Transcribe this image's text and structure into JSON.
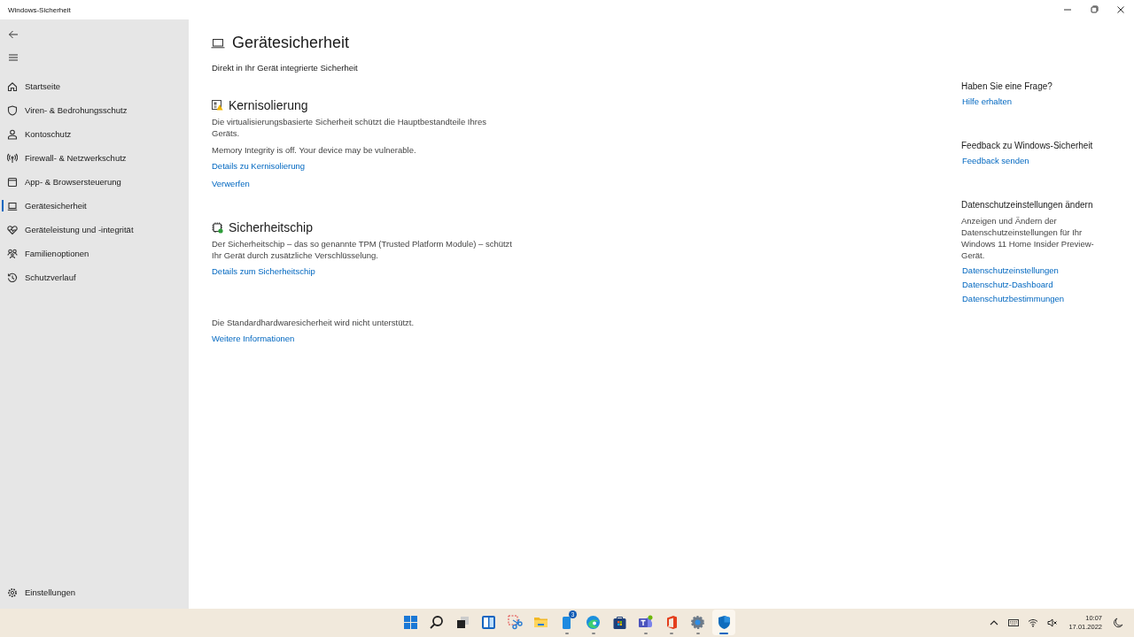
{
  "window": {
    "title": "Windows-Sicherheit"
  },
  "sidebar": {
    "items": [
      {
        "label": "Startseite",
        "selected": false
      },
      {
        "label": "Viren- & Bedrohungsschutz",
        "selected": false
      },
      {
        "label": "Kontoschutz",
        "selected": false
      },
      {
        "label": "Firewall- & Netzwerkschutz",
        "selected": false
      },
      {
        "label": "App- & Browsersteuerung",
        "selected": false
      },
      {
        "label": "Gerätesicherheit",
        "selected": true
      },
      {
        "label": "Geräteleistung und -integrität",
        "selected": false
      },
      {
        "label": "Familienoptionen",
        "selected": false
      },
      {
        "label": "Schutzverlauf",
        "selected": false
      }
    ],
    "footer": {
      "label": "Einstellungen"
    }
  },
  "page": {
    "title": "Gerätesicherheit",
    "subtitle": "Direkt in Ihr Gerät integrierte Sicherheit",
    "sections": [
      {
        "title": "Kernisolierung",
        "texts": [
          "Die virtualisierungsbasierte Sicherheit schützt die Hauptbestandteile Ihres Geräts.",
          "Memory Integrity is off. Your device may be vulnerable."
        ],
        "links": [
          "Details zu Kernisolierung",
          "Verwerfen"
        ]
      },
      {
        "title": "Sicherheitschip",
        "texts": [
          "Der Sicherheitschip – das so genannte TPM (Trusted Platform Module) – schützt Ihr Gerät durch zusätzliche Verschlüsselung."
        ],
        "links": [
          "Details zum Sicherheitschip"
        ]
      },
      {
        "texts": [
          "Die Standardhardwaresicherheit wird nicht unterstützt."
        ],
        "links": [
          "Weitere Informationen"
        ]
      }
    ]
  },
  "aside": [
    {
      "title": "Haben Sie eine Frage?",
      "links": [
        "Hilfe erhalten"
      ]
    },
    {
      "title": "Feedback zu Windows-Sicherheit",
      "links": [
        "Feedback senden"
      ]
    },
    {
      "title": "Datenschutzeinstellungen ändern",
      "description": "Anzeigen und Ändern der Datenschutzeinstellungen für Ihr Windows 11 Home Insider Preview-Gerät.",
      "links": [
        "Datenschutzeinstellungen",
        "Datenschutz-Dashboard",
        "Datenschutzbestimmungen"
      ]
    }
  ],
  "taskbar": {
    "apps": [
      {
        "kind": "start",
        "running": false,
        "selected": false
      },
      {
        "kind": "search",
        "running": false,
        "selected": false
      },
      {
        "kind": "taskview",
        "running": false,
        "selected": false
      },
      {
        "kind": "widgets",
        "running": false,
        "selected": false
      },
      {
        "kind": "snip",
        "running": false,
        "selected": false
      },
      {
        "kind": "folder",
        "running": false,
        "selected": false
      },
      {
        "kind": "phone",
        "running": true,
        "selected": false,
        "badge": "3"
      },
      {
        "kind": "edge",
        "running": true,
        "selected": false
      },
      {
        "kind": "store",
        "running": false,
        "selected": false
      },
      {
        "kind": "teams",
        "running": true,
        "selected": false
      },
      {
        "kind": "office",
        "running": true,
        "selected": false
      },
      {
        "kind": "settings",
        "running": true,
        "selected": false
      },
      {
        "kind": "security",
        "running": true,
        "selected": true
      }
    ],
    "time": "10:07",
    "date": "17.01.2022"
  }
}
